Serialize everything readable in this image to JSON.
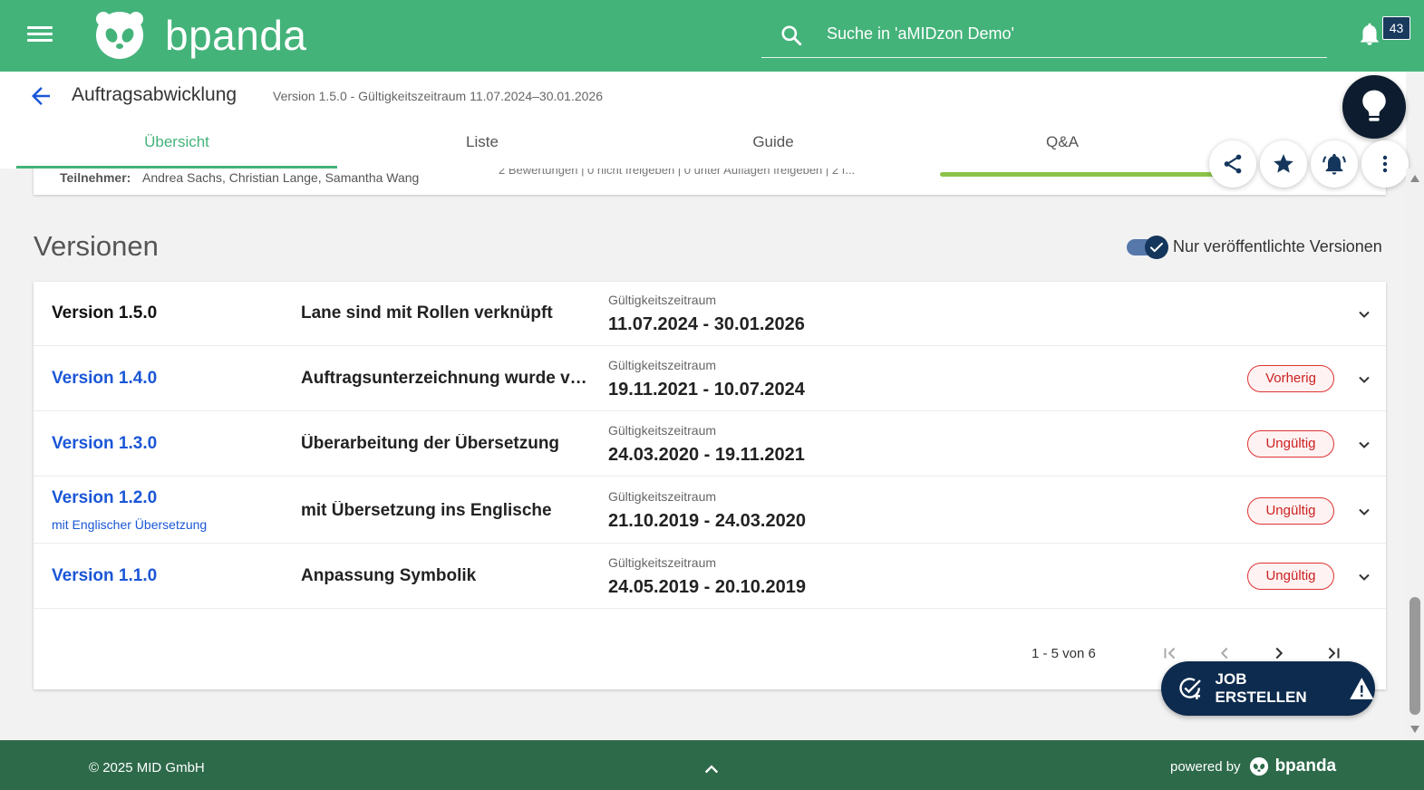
{
  "app": {
    "logo_text": "bpanda",
    "notification_count": "43"
  },
  "search": {
    "placeholder": "Suche in 'aMIDzon Demo'"
  },
  "header": {
    "title": "Auftragsabwicklung",
    "version_info": "Version 1.5.0 - Gültigkeitszeitraum 11.07.2024–30.01.2026"
  },
  "tabs": [
    {
      "label": "Übersicht",
      "active": true
    },
    {
      "label": "Liste",
      "active": false
    },
    {
      "label": "Guide",
      "active": false
    },
    {
      "label": "Q&A",
      "active": false
    }
  ],
  "previous_card": {
    "participants_label": "Teilnehmer:",
    "participants": "Andrea Sachs, Christian Lange, Samantha Wang",
    "ratings": "2 Bewertungen | 0 nicht freigeben | 0 unter Auflagen freigeben | 2 f..."
  },
  "versions": {
    "title": "Versionen",
    "toggle_label": "Nur veröffentlichte Versionen",
    "toggle_checked": true,
    "rows": [
      {
        "name": "Version 1.5.0",
        "subtitle": "",
        "description": "Lane sind mit Rollen verknüpft",
        "range_label": "Gültigkeitszeitraum",
        "range": "11.07.2024 - 30.01.2026",
        "badge": ""
      },
      {
        "name": "Version 1.4.0",
        "subtitle": "",
        "description": "Auftragsunterzeichnung wurde ver...",
        "range_label": "Gültigkeitszeitraum",
        "range": "19.11.2021 - 10.07.2024",
        "badge": "Vorherig"
      },
      {
        "name": "Version 1.3.0",
        "subtitle": "",
        "description": "Überarbeitung der Übersetzung",
        "range_label": "Gültigkeitszeitraum",
        "range": "24.03.2020 - 19.11.2021",
        "badge": "Ungültig"
      },
      {
        "name": "Version 1.2.0",
        "subtitle": "mit Englischer Übersetzung",
        "description": "mit Übersetzung ins Englische",
        "range_label": "Gültigkeitszeitraum",
        "range": "21.10.2019 - 24.03.2020",
        "badge": "Ungültig"
      },
      {
        "name": "Version 1.1.0",
        "subtitle": "",
        "description": "Anpassung Symbolik",
        "range_label": "Gültigkeitszeitraum",
        "range": "24.05.2019 - 20.10.2019",
        "badge": "Ungültig"
      }
    ],
    "pagination": "1 - 5 von 6"
  },
  "job_button": {
    "label": "JOB ERSTELLEN"
  },
  "footer": {
    "copyright": "© 2025 MID GmbH",
    "powered_by": "powered by",
    "powered_logo": "bpanda"
  },
  "colors": {
    "primary_green": "#44b37a",
    "footer_green": "#2d6a4a",
    "navy": "#0d2b4e",
    "link_blue": "#1a56d6",
    "danger": "#d33"
  },
  "icons": [
    "menu-icon",
    "panda-logo-icon",
    "search-icon",
    "bell-icon",
    "back-arrow-icon",
    "lightbulb-icon",
    "share-icon",
    "star-icon",
    "bell-active-icon",
    "more-vert-icon",
    "check-icon",
    "chevron-down-icon",
    "first-page-icon",
    "prev-page-icon",
    "next-page-icon",
    "last-page-icon",
    "add-task-icon",
    "warning-icon",
    "chevron-up-icon"
  ]
}
